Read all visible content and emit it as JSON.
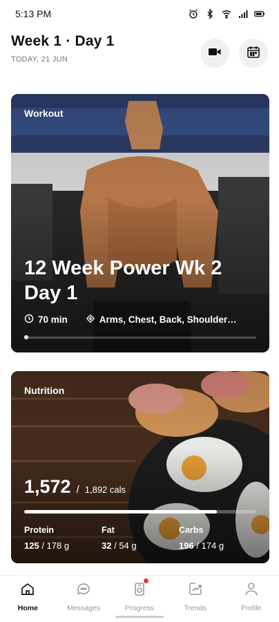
{
  "status_bar": {
    "time": "5:13 PM",
    "icons": [
      "alarm-icon",
      "bluetooth-icon",
      "wifi-icon",
      "signal-icon",
      "battery-icon"
    ]
  },
  "header": {
    "title": "Week 1 · Day 1",
    "date": "TODAY, 21 JUN",
    "actions": [
      "video-camera-icon",
      "calendar-icon"
    ]
  },
  "workout": {
    "label": "Workout",
    "title": "12 Week Power Wk 2 Day 1",
    "duration": "70 min",
    "muscles": "Arms, Chest, Back, Shoulder…",
    "progress_fraction": 0.0
  },
  "nutrition": {
    "label": "Nutrition",
    "calories_current": "1,572",
    "calories_goal": "1,892 cals",
    "calories_fraction": 0.83,
    "macros": [
      {
        "name": "Protein",
        "current": "125",
        "goal": "178 g"
      },
      {
        "name": "Fat",
        "current": "32",
        "goal": "54 g"
      },
      {
        "name": "Carbs",
        "current": "196",
        "goal": "174 g"
      }
    ]
  },
  "bottom_nav": {
    "items": [
      {
        "label": "Home",
        "icon": "home-icon",
        "active": true
      },
      {
        "label": "Messages",
        "icon": "chat-bubble-icon",
        "active": false
      },
      {
        "label": "Progress",
        "icon": "progress-icon",
        "active": false,
        "badge": true
      },
      {
        "label": "Trends",
        "icon": "trends-icon",
        "active": false
      },
      {
        "label": "Profile",
        "icon": "profile-icon",
        "active": false
      }
    ]
  },
  "colors": {
    "badge": "#e53935",
    "active_nav": "#111111",
    "inactive_nav": "#999999"
  }
}
